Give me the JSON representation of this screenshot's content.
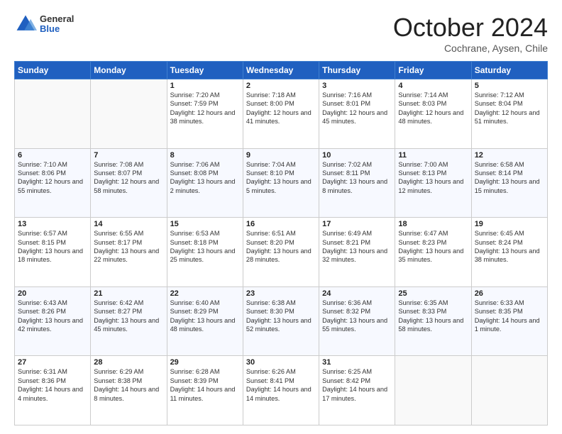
{
  "header": {
    "logo_general": "General",
    "logo_blue": "Blue",
    "month": "October 2024",
    "location": "Cochrane, Aysen, Chile"
  },
  "weekdays": [
    "Sunday",
    "Monday",
    "Tuesday",
    "Wednesday",
    "Thursday",
    "Friday",
    "Saturday"
  ],
  "weeks": [
    [
      {
        "day": "",
        "text": ""
      },
      {
        "day": "",
        "text": ""
      },
      {
        "day": "1",
        "text": "Sunrise: 7:20 AM\nSunset: 7:59 PM\nDaylight: 12 hours and 38 minutes."
      },
      {
        "day": "2",
        "text": "Sunrise: 7:18 AM\nSunset: 8:00 PM\nDaylight: 12 hours and 41 minutes."
      },
      {
        "day": "3",
        "text": "Sunrise: 7:16 AM\nSunset: 8:01 PM\nDaylight: 12 hours and 45 minutes."
      },
      {
        "day": "4",
        "text": "Sunrise: 7:14 AM\nSunset: 8:03 PM\nDaylight: 12 hours and 48 minutes."
      },
      {
        "day": "5",
        "text": "Sunrise: 7:12 AM\nSunset: 8:04 PM\nDaylight: 12 hours and 51 minutes."
      }
    ],
    [
      {
        "day": "6",
        "text": "Sunrise: 7:10 AM\nSunset: 8:06 PM\nDaylight: 12 hours and 55 minutes."
      },
      {
        "day": "7",
        "text": "Sunrise: 7:08 AM\nSunset: 8:07 PM\nDaylight: 12 hours and 58 minutes."
      },
      {
        "day": "8",
        "text": "Sunrise: 7:06 AM\nSunset: 8:08 PM\nDaylight: 13 hours and 2 minutes."
      },
      {
        "day": "9",
        "text": "Sunrise: 7:04 AM\nSunset: 8:10 PM\nDaylight: 13 hours and 5 minutes."
      },
      {
        "day": "10",
        "text": "Sunrise: 7:02 AM\nSunset: 8:11 PM\nDaylight: 13 hours and 8 minutes."
      },
      {
        "day": "11",
        "text": "Sunrise: 7:00 AM\nSunset: 8:13 PM\nDaylight: 13 hours and 12 minutes."
      },
      {
        "day": "12",
        "text": "Sunrise: 6:58 AM\nSunset: 8:14 PM\nDaylight: 13 hours and 15 minutes."
      }
    ],
    [
      {
        "day": "13",
        "text": "Sunrise: 6:57 AM\nSunset: 8:15 PM\nDaylight: 13 hours and 18 minutes."
      },
      {
        "day": "14",
        "text": "Sunrise: 6:55 AM\nSunset: 8:17 PM\nDaylight: 13 hours and 22 minutes."
      },
      {
        "day": "15",
        "text": "Sunrise: 6:53 AM\nSunset: 8:18 PM\nDaylight: 13 hours and 25 minutes."
      },
      {
        "day": "16",
        "text": "Sunrise: 6:51 AM\nSunset: 8:20 PM\nDaylight: 13 hours and 28 minutes."
      },
      {
        "day": "17",
        "text": "Sunrise: 6:49 AM\nSunset: 8:21 PM\nDaylight: 13 hours and 32 minutes."
      },
      {
        "day": "18",
        "text": "Sunrise: 6:47 AM\nSunset: 8:23 PM\nDaylight: 13 hours and 35 minutes."
      },
      {
        "day": "19",
        "text": "Sunrise: 6:45 AM\nSunset: 8:24 PM\nDaylight: 13 hours and 38 minutes."
      }
    ],
    [
      {
        "day": "20",
        "text": "Sunrise: 6:43 AM\nSunset: 8:26 PM\nDaylight: 13 hours and 42 minutes."
      },
      {
        "day": "21",
        "text": "Sunrise: 6:42 AM\nSunset: 8:27 PM\nDaylight: 13 hours and 45 minutes."
      },
      {
        "day": "22",
        "text": "Sunrise: 6:40 AM\nSunset: 8:29 PM\nDaylight: 13 hours and 48 minutes."
      },
      {
        "day": "23",
        "text": "Sunrise: 6:38 AM\nSunset: 8:30 PM\nDaylight: 13 hours and 52 minutes."
      },
      {
        "day": "24",
        "text": "Sunrise: 6:36 AM\nSunset: 8:32 PM\nDaylight: 13 hours and 55 minutes."
      },
      {
        "day": "25",
        "text": "Sunrise: 6:35 AM\nSunset: 8:33 PM\nDaylight: 13 hours and 58 minutes."
      },
      {
        "day": "26",
        "text": "Sunrise: 6:33 AM\nSunset: 8:35 PM\nDaylight: 14 hours and 1 minute."
      }
    ],
    [
      {
        "day": "27",
        "text": "Sunrise: 6:31 AM\nSunset: 8:36 PM\nDaylight: 14 hours and 4 minutes."
      },
      {
        "day": "28",
        "text": "Sunrise: 6:29 AM\nSunset: 8:38 PM\nDaylight: 14 hours and 8 minutes."
      },
      {
        "day": "29",
        "text": "Sunrise: 6:28 AM\nSunset: 8:39 PM\nDaylight: 14 hours and 11 minutes."
      },
      {
        "day": "30",
        "text": "Sunrise: 6:26 AM\nSunset: 8:41 PM\nDaylight: 14 hours and 14 minutes."
      },
      {
        "day": "31",
        "text": "Sunrise: 6:25 AM\nSunset: 8:42 PM\nDaylight: 14 hours and 17 minutes."
      },
      {
        "day": "",
        "text": ""
      },
      {
        "day": "",
        "text": ""
      }
    ]
  ]
}
